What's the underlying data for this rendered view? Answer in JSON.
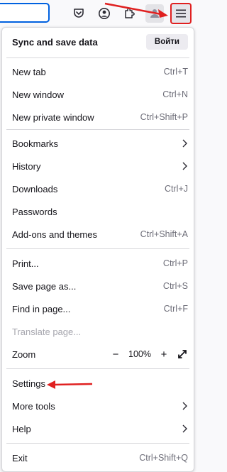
{
  "toolbar": {
    "icons": [
      "pocket-icon",
      "account-icon",
      "extensions-icon",
      "sync-icon",
      "menu-icon"
    ]
  },
  "menu": {
    "sync": {
      "label": "Sync and save data",
      "button": "Войти"
    },
    "new_tab": {
      "label": "New tab",
      "shortcut": "Ctrl+T"
    },
    "new_window": {
      "label": "New window",
      "shortcut": "Ctrl+N"
    },
    "new_private": {
      "label": "New private window",
      "shortcut": "Ctrl+Shift+P"
    },
    "bookmarks": {
      "label": "Bookmarks"
    },
    "history": {
      "label": "History"
    },
    "downloads": {
      "label": "Downloads",
      "shortcut": "Ctrl+J"
    },
    "passwords": {
      "label": "Passwords"
    },
    "addons": {
      "label": "Add-ons and themes",
      "shortcut": "Ctrl+Shift+A"
    },
    "print": {
      "label": "Print...",
      "shortcut": "Ctrl+P"
    },
    "save_page": {
      "label": "Save page as...",
      "shortcut": "Ctrl+S"
    },
    "find": {
      "label": "Find in page...",
      "shortcut": "Ctrl+F"
    },
    "translate": {
      "label": "Translate page..."
    },
    "zoom": {
      "label": "Zoom",
      "minus": "−",
      "value": "100%",
      "plus": "+"
    },
    "settings": {
      "label": "Settings"
    },
    "more_tools": {
      "label": "More tools"
    },
    "help": {
      "label": "Help"
    },
    "exit": {
      "label": "Exit",
      "shortcut": "Ctrl+Shift+Q"
    }
  },
  "colors": {
    "annotation": "#e02020",
    "accent": "#0061e0"
  }
}
